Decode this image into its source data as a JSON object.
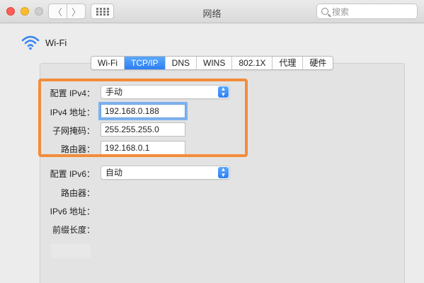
{
  "window": {
    "title": "网络"
  },
  "titlebar": {
    "back_glyph": "〈",
    "forward_glyph": "〉",
    "search_placeholder": "搜索"
  },
  "header": {
    "interface_name": "Wi-Fi",
    "icon": "wifi-icon"
  },
  "tabs": [
    {
      "label": "Wi-Fi",
      "active": false
    },
    {
      "label": "TCP/IP",
      "active": true
    },
    {
      "label": "DNS",
      "active": false
    },
    {
      "label": "WINS",
      "active": false
    },
    {
      "label": "802.1X",
      "active": false
    },
    {
      "label": "代理",
      "active": false
    },
    {
      "label": "硬件",
      "active": false
    }
  ],
  "ipv4": {
    "configure_label": "配置 IPv4：",
    "configure_value": "手动",
    "address_label": "IPv4 地址：",
    "address_value": "192.168.0.188",
    "subnet_label": "子网掩码：",
    "subnet_value": "255.255.255.0",
    "router_label": "路由器：",
    "router_value": "192.168.0.1"
  },
  "ipv6": {
    "configure_label": "配置 IPv6：",
    "configure_value": "自动",
    "router_label": "路由器：",
    "address_label": "IPv6 地址：",
    "prefix_label": "前缀长度："
  },
  "colors": {
    "accent": "#2d7ff5",
    "highlight": "#f28c3b",
    "close": "#fc5f57",
    "minimize": "#fdbc2e"
  }
}
